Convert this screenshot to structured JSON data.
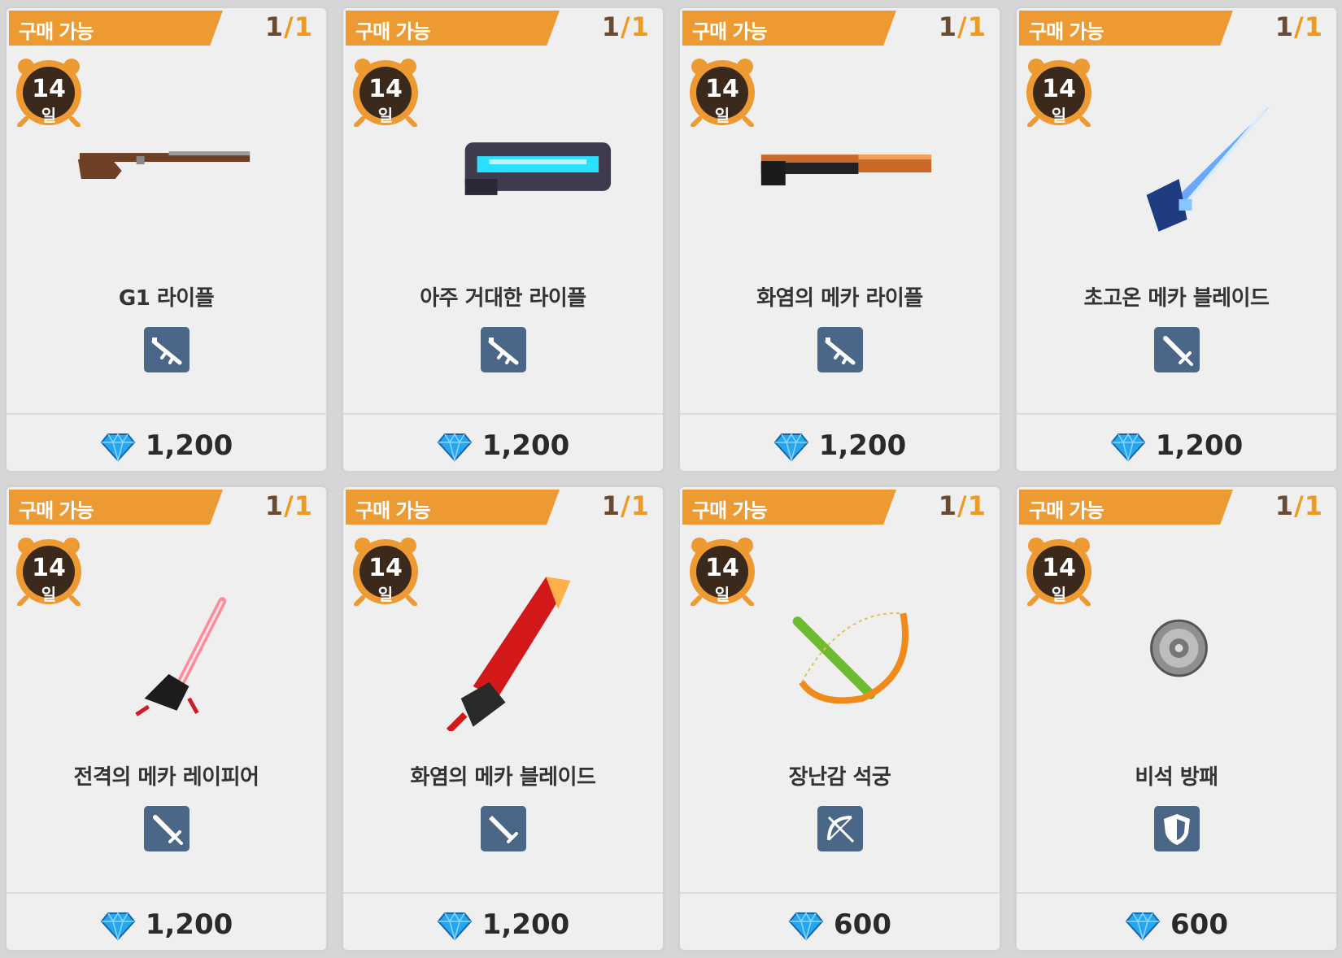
{
  "items": [
    {
      "badge": "구매 가능",
      "stock_current": "1",
      "stock_sep": "/",
      "stock_max": "1",
      "duration": "14",
      "duration_unit": "일",
      "name": "G1 라이플",
      "type_icon": "rifle-type-icon",
      "image_icon": "rifle-icon",
      "price": "1,200",
      "currency_icon": "diamond-icon"
    },
    {
      "badge": "구매 가능",
      "stock_current": "1",
      "stock_sep": "/",
      "stock_max": "1",
      "duration": "14",
      "duration_unit": "일",
      "name": "아주 거대한 라이플",
      "type_icon": "rifle-type-icon",
      "image_icon": "heavy-rifle-icon",
      "price": "1,200",
      "currency_icon": "diamond-icon"
    },
    {
      "badge": "구매 가능",
      "stock_current": "1",
      "stock_sep": "/",
      "stock_max": "1",
      "duration": "14",
      "duration_unit": "일",
      "name": "화염의 메카 라이플",
      "type_icon": "rifle-type-icon",
      "image_icon": "flame-rifle-icon",
      "price": "1,200",
      "currency_icon": "diamond-icon"
    },
    {
      "badge": "구매 가능",
      "stock_current": "1",
      "stock_sep": "/",
      "stock_max": "1",
      "duration": "14",
      "duration_unit": "일",
      "name": "초고온 메카 블레이드",
      "type_icon": "sword-type-icon",
      "image_icon": "mecha-blade-icon",
      "price": "1,200",
      "currency_icon": "diamond-icon"
    },
    {
      "badge": "구매 가능",
      "stock_current": "1",
      "stock_sep": "/",
      "stock_max": "1",
      "duration": "14",
      "duration_unit": "일",
      "name": "전격의 메카 레이피어",
      "type_icon": "sword-type-icon",
      "image_icon": "rapier-icon",
      "price": "1,200",
      "currency_icon": "diamond-icon"
    },
    {
      "badge": "구매 가능",
      "stock_current": "1",
      "stock_sep": "/",
      "stock_max": "1",
      "duration": "14",
      "duration_unit": "일",
      "name": "화염의 메카 블레이드",
      "type_icon": "greatsword-type-icon",
      "image_icon": "flame-blade-icon",
      "price": "1,200",
      "currency_icon": "diamond-icon"
    },
    {
      "badge": "구매 가능",
      "stock_current": "1",
      "stock_sep": "/",
      "stock_max": "1",
      "duration": "14",
      "duration_unit": "일",
      "name": "장난감 석궁",
      "type_icon": "bow-type-icon",
      "image_icon": "crossbow-icon",
      "price": "600",
      "currency_icon": "diamond-icon"
    },
    {
      "badge": "구매 가능",
      "stock_current": "1",
      "stock_sep": "/",
      "stock_max": "1",
      "duration": "14",
      "duration_unit": "일",
      "name": "비석 방패",
      "type_icon": "shield-type-icon",
      "image_icon": "stone-shield-icon",
      "price": "600",
      "currency_icon": "diamond-icon"
    }
  ],
  "colors": {
    "banner": "#ec9a31",
    "type_icon_bg": "#4b6788",
    "timer_ring": "#ec9a31",
    "timer_face": "#3b2a1c",
    "gem": "#27a6f0"
  }
}
